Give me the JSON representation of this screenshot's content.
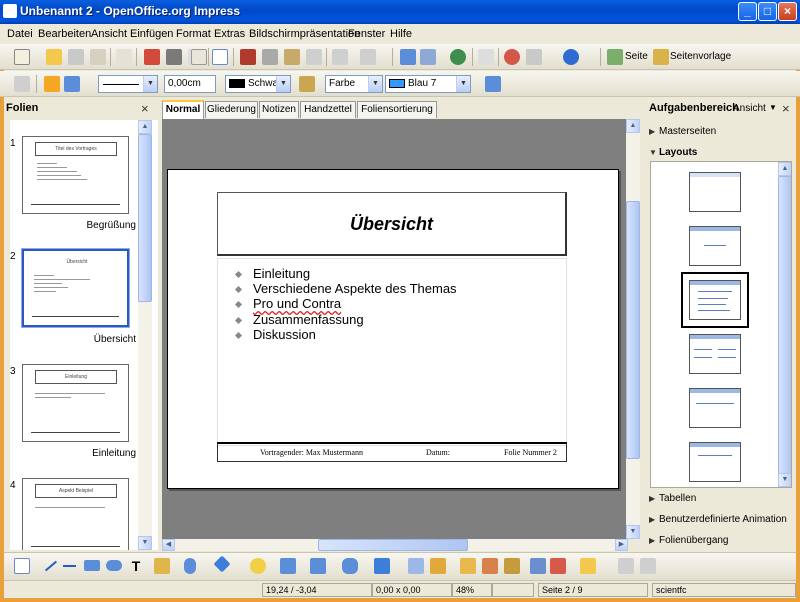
{
  "window": {
    "title": "Unbenannt 2 - OpenOffice.org Impress",
    "min": "_",
    "max": "□",
    "close": "×"
  },
  "menu": [
    "Datei",
    "Bearbeiten",
    "Ansicht",
    "Einfügen",
    "Format",
    "Extras",
    "Bildschirmpräsentation",
    "Fenster",
    "Hilfe"
  ],
  "toolbar1": {
    "seite_label": "Seite",
    "seitenvorlage_label": "Seitenvorlage"
  },
  "toolbar2": {
    "line_width": "0,00cm",
    "line_color": "Schwarz",
    "fill_type": "Farbe",
    "fill_color": "Blau 7",
    "accent": "#3399FF"
  },
  "left_panel": {
    "title": "Folien",
    "slides": [
      {
        "num": "1",
        "name": "Begrüßung",
        "thumb_title": "Titel des Vortrages"
      },
      {
        "num": "2",
        "name": "Übersicht",
        "thumb_title": "Übersicht"
      },
      {
        "num": "3",
        "name": "Einleitung",
        "thumb_title": "Einleitung"
      },
      {
        "num": "4",
        "name": "",
        "thumb_title": "Aspekt Beispiel"
      }
    ]
  },
  "view_tabs": [
    "Normal",
    "Gliederung",
    "Notizen",
    "Handzettel",
    "Foliensortierung"
  ],
  "slide": {
    "title": "Übersicht",
    "bullets": [
      "Einleitung",
      "Verschiedene Aspekte des Themas",
      "Pro und Contra",
      "Zusammenfassung",
      "Diskussion"
    ],
    "footer_left": "Vortragender: Max Mustermann",
    "footer_mid": "Datum:",
    "footer_right": "Folie Nummer 2"
  },
  "right_panel": {
    "title": "Aufgabenbereich",
    "view_label": "Ansicht",
    "sections": {
      "masterseiten": "Masterseiten",
      "layouts": "Layouts",
      "tabellen": "Tabellen",
      "animation": "Benutzerdefinierte Animation",
      "uebergang": "Folienübergang"
    }
  },
  "status": {
    "position": "19,24 / -3,04",
    "size": "0,00 x 0,00",
    "zoom": "48%",
    "page": "Seite 2 / 9",
    "template": "scientfc"
  }
}
